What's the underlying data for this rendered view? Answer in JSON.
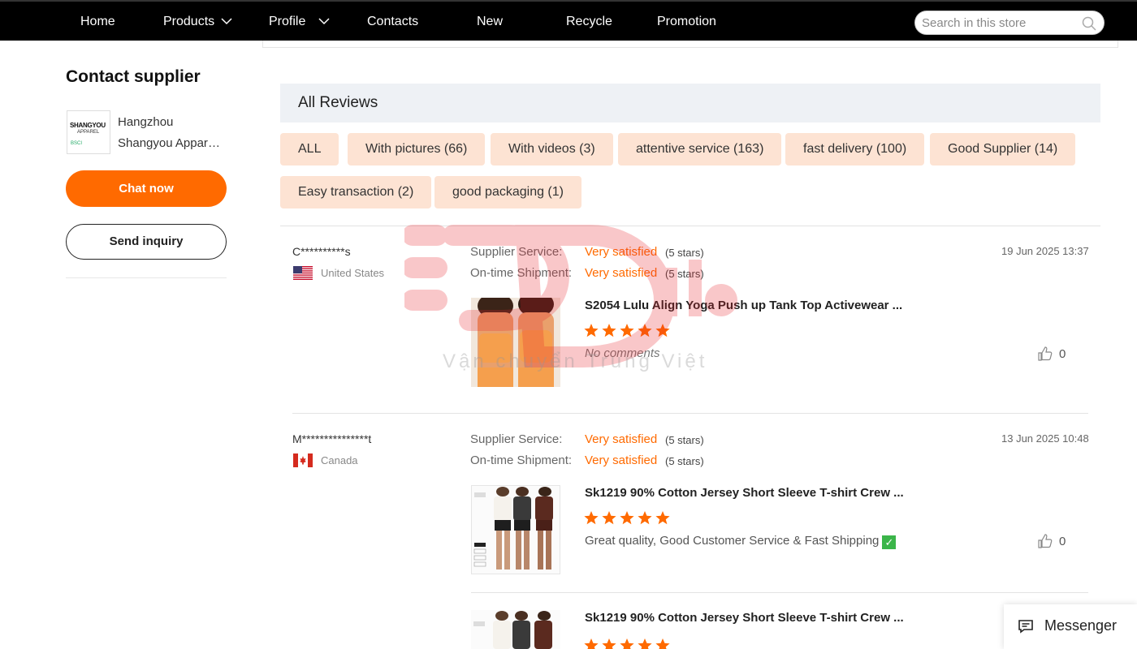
{
  "nav": {
    "items": [
      "Home",
      "Products",
      "Profile",
      "Contacts",
      "New",
      "Recycle",
      "Promotion"
    ],
    "search_placeholder": "Search in this store"
  },
  "sidebar": {
    "title": "Contact supplier",
    "logo_text": "SHANGYOU",
    "logo_sub": "APPAREL",
    "logo_badge": "BSCI",
    "supplier_line1": "Hangzhou",
    "supplier_line2": "Shangyou Apparel...",
    "chat_label": "Chat now",
    "inquiry_label": "Send inquiry"
  },
  "reviews": {
    "title": "All Reviews",
    "filters": [
      "ALL",
      "With pictures (66)",
      "With videos (3)",
      "attentive service (163)",
      "fast delivery (100)",
      "Good Supplier (14)",
      "Easy transaction (2)",
      "good packaging (1)"
    ],
    "supplier_service_label": "Supplier Service:",
    "shipment_label": "On-time Shipment:",
    "items": [
      {
        "reviewer": "C**********s",
        "country": "United States",
        "service_rating": "Very satisfied",
        "service_stars": "(5 stars)",
        "shipment_rating": "Very satisfied",
        "shipment_stars": "(5 stars)",
        "date": "19 Jun 2025 13:37",
        "product_title": "S2054 Lulu Align Yoga Push up Tank Top Activewear ...",
        "rating": 5,
        "comment": "No comments",
        "likes": "0"
      },
      {
        "reviewer": "M***************t",
        "country": "Canada",
        "service_rating": "Very satisfied",
        "service_stars": "(5 stars)",
        "shipment_rating": "Very satisfied",
        "shipment_stars": "(5 stars)",
        "date": "13 Jun 2025 10:48",
        "product_title": "Sk1219 90% Cotton Jersey Short Sleeve T-shirt Crew ...",
        "rating": 5,
        "comment": "Great quality, Good Customer Service & Fast Shipping",
        "likes": "0",
        "extra_product_title": "Sk1219 90% Cotton Jersey Short Sleeve T-shirt Crew ...",
        "extra_rating": 5
      }
    ]
  },
  "watermark": {
    "text": "Vận chuyển Trung Việt"
  },
  "messenger": {
    "label": "Messenger"
  },
  "colors": {
    "accent": "#ff6a00",
    "filter_bg": "#fde3d3",
    "header_bg": "#eef1f5",
    "nav_bg": "#000000"
  }
}
